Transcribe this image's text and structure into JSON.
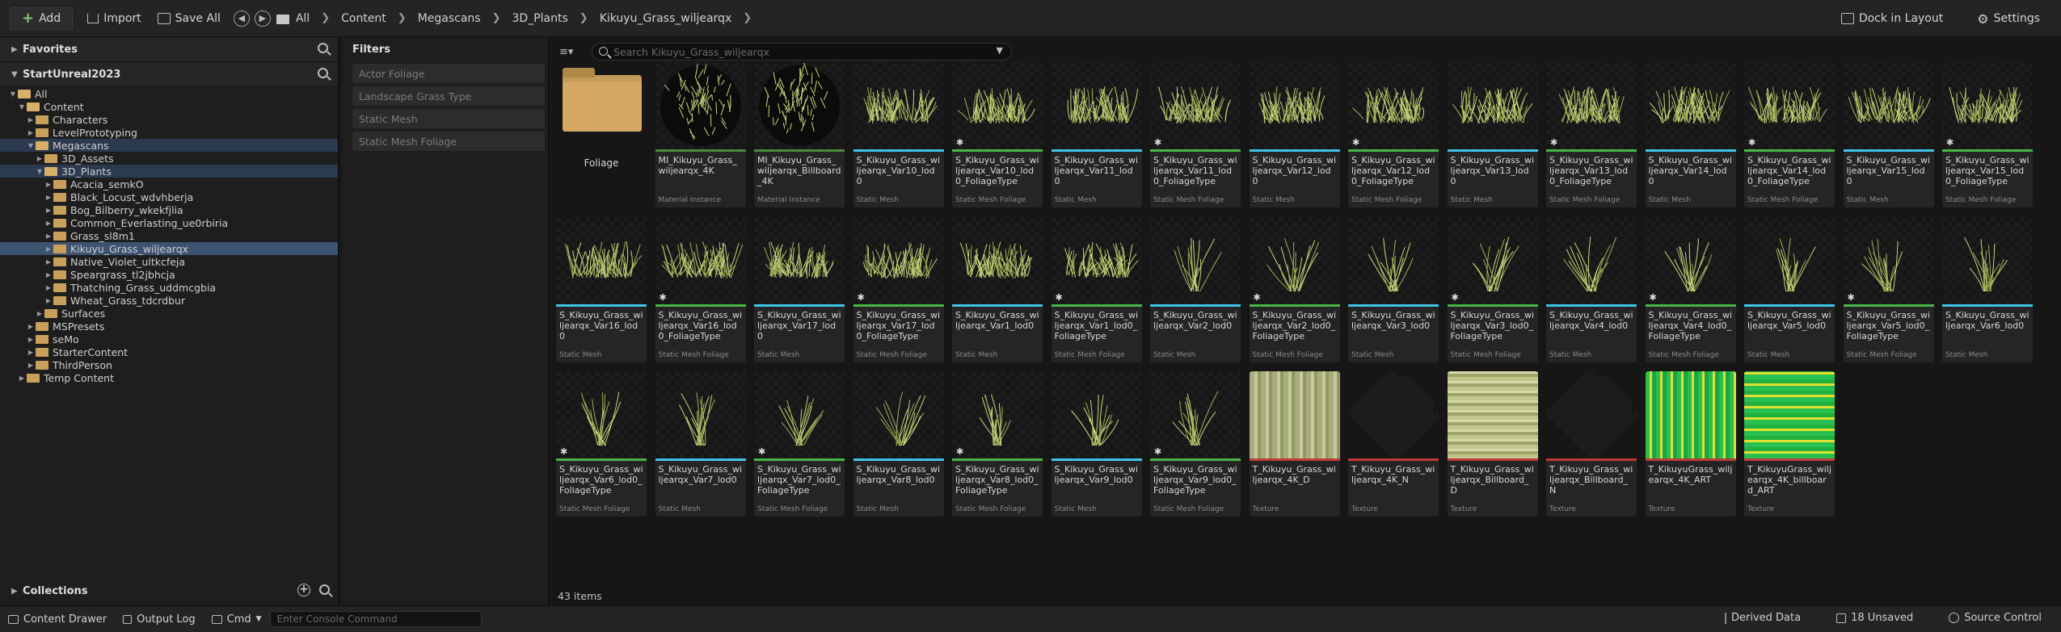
{
  "toolbar": {
    "add_label": "Add",
    "import_label": "Import",
    "save_all_label": "Save All",
    "breadcrumb": [
      "All",
      "Content",
      "Megascans",
      "3D_Plants",
      "Kikuyu_Grass_wiljearqx"
    ],
    "dock_label": "Dock in Layout",
    "settings_label": "Settings"
  },
  "left_panel": {
    "favorites_label": "Favorites",
    "project_label": "StartUnreal2023",
    "collections_label": "Collections",
    "tree": [
      {
        "label": "All",
        "depth": 0,
        "expanded": true
      },
      {
        "label": "Content",
        "depth": 1,
        "expanded": true
      },
      {
        "label": "Characters",
        "depth": 2,
        "expanded": false
      },
      {
        "label": "LevelPrototyping",
        "depth": 2,
        "expanded": false
      },
      {
        "label": "Megascans",
        "depth": 2,
        "expanded": true,
        "highlight": true
      },
      {
        "label": "3D_Assets",
        "depth": 3,
        "expanded": false
      },
      {
        "label": "3D_Plants",
        "depth": 3,
        "expanded": true,
        "highlight": true
      },
      {
        "label": "Acacia_semkO",
        "depth": 4,
        "expanded": false
      },
      {
        "label": "Black_Locust_wdvhberja",
        "depth": 4,
        "expanded": false
      },
      {
        "label": "Bog_Bilberry_wkekfjlia",
        "depth": 4,
        "expanded": false
      },
      {
        "label": "Common_Everlasting_ue0rbiria",
        "depth": 4,
        "expanded": false
      },
      {
        "label": "Grass_sl8m1",
        "depth": 4,
        "expanded": false
      },
      {
        "label": "Kikuyu_Grass_wiljearqx",
        "depth": 4,
        "expanded": false,
        "selected": true
      },
      {
        "label": "Native_Violet_ultkcfeja",
        "depth": 4,
        "expanded": false
      },
      {
        "label": "Speargrass_tl2jbhcja",
        "depth": 4,
        "expanded": false
      },
      {
        "label": "Thatching_Grass_uddmcgbia",
        "depth": 4,
        "expanded": false
      },
      {
        "label": "Wheat_Grass_tdcrdbur",
        "depth": 4,
        "expanded": false
      },
      {
        "label": "Surfaces",
        "depth": 3,
        "expanded": false
      },
      {
        "label": "MSPresets",
        "depth": 2,
        "expanded": false
      },
      {
        "label": "seMo",
        "depth": 2,
        "expanded": false
      },
      {
        "label": "StarterContent",
        "depth": 2,
        "expanded": false
      },
      {
        "label": "ThirdPerson",
        "depth": 2,
        "expanded": false
      },
      {
        "label": "Temp Content",
        "depth": 1,
        "expanded": false
      }
    ]
  },
  "filters": {
    "title": "Filters",
    "items": [
      "Actor Foliage",
      "Landscape Grass Type",
      "Static Mesh",
      "Static Mesh Foliage"
    ]
  },
  "main": {
    "search_placeholder": "Search Kikuyu_Grass_wiljearqx",
    "item_count": "43 items",
    "folder_label": "Foliage",
    "tiles": [
      {
        "name": "MI_Kikuyu_Grass_wiljearqx_4K",
        "type": "Material Instance",
        "kind": "sphere",
        "star": false
      },
      {
        "name": "MI_Kikuyu_Grass_wiljearqx_Billboard_4K",
        "type": "Material Instance",
        "kind": "sphere",
        "star": false
      },
      {
        "name": "S_Kikuyu_Grass_wiljearqx_Var10_lod0",
        "type": "Static Mesh",
        "kind": "grass",
        "star": false
      },
      {
        "name": "S_Kikuyu_Grass_wiljearqx_Var10_lod0_FoliageType",
        "type": "Static Mesh Foliage",
        "kind": "grass",
        "star": true
      },
      {
        "name": "S_Kikuyu_Grass_wiljearqx_Var11_lod0",
        "type": "Static Mesh",
        "kind": "grass",
        "star": false
      },
      {
        "name": "S_Kikuyu_Grass_wiljearqx_Var11_lod0_FoliageType",
        "type": "Static Mesh Foliage",
        "kind": "grass",
        "star": true
      },
      {
        "name": "S_Kikuyu_Grass_wiljearqx_Var12_lod0",
        "type": "Static Mesh",
        "kind": "grass",
        "star": false
      },
      {
        "name": "S_Kikuyu_Grass_wiljearqx_Var12_lod0_FoliageType",
        "type": "Static Mesh Foliage",
        "kind": "grass",
        "star": true
      },
      {
        "name": "S_Kikuyu_Grass_wiljearqx_Var13_lod0",
        "type": "Static Mesh",
        "kind": "grass",
        "star": false
      },
      {
        "name": "S_Kikuyu_Grass_wiljearqx_Var13_lod0_FoliageType",
        "type": "Static Mesh Foliage",
        "kind": "grass",
        "star": true
      },
      {
        "name": "S_Kikuyu_Grass_wiljearqx_Var14_lod0",
        "type": "Static Mesh",
        "kind": "grass",
        "star": false
      },
      {
        "name": "S_Kikuyu_Grass_wiljearqx_Var14_lod0_FoliageType",
        "type": "Static Mesh Foliage",
        "kind": "grass",
        "star": true
      },
      {
        "name": "S_Kikuyu_Grass_wiljearqx_Var15_lod0",
        "type": "Static Mesh",
        "kind": "grass",
        "star": false
      },
      {
        "name": "S_Kikuyu_Grass_wiljearqx_Var15_lod0_FoliageType",
        "type": "Static Mesh Foliage",
        "kind": "grass",
        "star": true
      },
      {
        "name": "S_Kikuyu_Grass_wiljearqx_Var16_lod0",
        "type": "Static Mesh",
        "kind": "grass",
        "star": false
      },
      {
        "name": "S_Kikuyu_Grass_wiljearqx_Var16_lod0_FoliageType",
        "type": "Static Mesh Foliage",
        "kind": "grass",
        "star": true
      },
      {
        "name": "S_Kikuyu_Grass_wiljearqx_Var17_lod0",
        "type": "Static Mesh",
        "kind": "grass",
        "star": false
      },
      {
        "name": "S_Kikuyu_Grass_wiljearqx_Var17_lod0_FoliageType",
        "type": "Static Mesh Foliage",
        "kind": "grass",
        "star": true
      },
      {
        "name": "S_Kikuyu_Grass_wiljearqx_Var1_lod0",
        "type": "Static Mesh",
        "kind": "grass",
        "star": false
      },
      {
        "name": "S_Kikuyu_Grass_wiljearqx_Var1_lod0_FoliageType",
        "type": "Static Mesh Foliage",
        "kind": "grass",
        "star": true
      },
      {
        "name": "S_Kikuyu_Grass_wiljearqx_Var2_lod0",
        "type": "Static Mesh",
        "kind": "tuft",
        "star": false
      },
      {
        "name": "S_Kikuyu_Grass_wiljearqx_Var2_lod0_FoliageType",
        "type": "Static Mesh Foliage",
        "kind": "tuft",
        "star": true
      },
      {
        "name": "S_Kikuyu_Grass_wiljearqx_Var3_lod0",
        "type": "Static Mesh",
        "kind": "tuft",
        "star": false
      },
      {
        "name": "S_Kikuyu_Grass_wiljearqx_Var3_lod0_FoliageType",
        "type": "Static Mesh Foliage",
        "kind": "tuft",
        "star": true
      },
      {
        "name": "S_Kikuyu_Grass_wiljearqx_Var4_lod0",
        "type": "Static Mesh",
        "kind": "tuft",
        "star": false
      },
      {
        "name": "S_Kikuyu_Grass_wiljearqx_Var4_lod0_FoliageType",
        "type": "Static Mesh Foliage",
        "kind": "tuft",
        "star": true
      },
      {
        "name": "S_Kikuyu_Grass_wiljearqx_Var5_lod0",
        "type": "Static Mesh",
        "kind": "tuft",
        "star": false
      },
      {
        "name": "S_Kikuyu_Grass_wiljearqx_Var5_lod0_FoliageType",
        "type": "Static Mesh Foliage",
        "kind": "tuft",
        "star": true
      },
      {
        "name": "S_Kikuyu_Grass_wiljearqx_Var6_lod0",
        "type": "Static Mesh",
        "kind": "tuft",
        "star": false
      },
      {
        "name": "S_Kikuyu_Grass_wiljearqx_Var6_lod0_FoliageType",
        "type": "Static Mesh Foliage",
        "kind": "tuft",
        "star": true
      },
      {
        "name": "S_Kikuyu_Grass_wiljearqx_Var7_lod0",
        "type": "Static Mesh",
        "kind": "tuft",
        "star": false
      },
      {
        "name": "S_Kikuyu_Grass_wiljearqx_Var7_lod0_FoliageType",
        "type": "Static Mesh Foliage",
        "kind": "tuft",
        "star": true
      },
      {
        "name": "S_Kikuyu_Grass_wiljearqx_Var8_lod0",
        "type": "Static Mesh",
        "kind": "tuft",
        "star": false
      },
      {
        "name": "S_Kikuyu_Grass_wiljearqx_Var8_lod0_FoliageType",
        "type": "Static Mesh Foliage",
        "kind": "tuft",
        "star": true
      },
      {
        "name": "S_Kikuyu_Grass_wiljearqx_Var9_lod0",
        "type": "Static Mesh",
        "kind": "tuft",
        "star": false
      },
      {
        "name": "S_Kikuyu_Grass_wiljearqx_Var9_lod0_FoliageType",
        "type": "Static Mesh Foliage",
        "kind": "tuft",
        "star": true
      },
      {
        "name": "T_Kikuyu_Grass_wiljearqx_4K_D",
        "type": "Texture",
        "kind": "tex_d",
        "star": false
      },
      {
        "name": "T_Kikuyu_Grass_wiljearqx_4K_N",
        "type": "Texture",
        "kind": "tex_n",
        "star": false
      },
      {
        "name": "T_Kikuyu_Grass_wiljearqx_Billboard_D",
        "type": "Texture",
        "kind": "tex_bd",
        "star": false
      },
      {
        "name": "T_Kikuyu_Grass_wiljearqx_Billboard_N",
        "type": "Texture",
        "kind": "tex_bn",
        "star": false
      },
      {
        "name": "T_KikuyuGrass_wiljearqx_4K_ART",
        "type": "Texture",
        "kind": "tex_art",
        "star": false
      },
      {
        "name": "T_KikuyuGrass_wiljearqx_4K_billboard_ART",
        "type": "Texture",
        "kind": "tex_bart",
        "star": false
      }
    ]
  },
  "type_colors": {
    "Material Instance": "#4a8a3c",
    "Static Mesh": "#3ec4e6",
    "Static Mesh Foliage": "#47b547",
    "Texture": "#c03a3a"
  },
  "statusbar": {
    "content_drawer": "Content Drawer",
    "output_log": "Output Log",
    "cmd": "Cmd",
    "console_placeholder": "Enter Console Command",
    "derived_data": "Derived Data",
    "unsaved": "18 Unsaved",
    "source_control": "Source Control"
  }
}
